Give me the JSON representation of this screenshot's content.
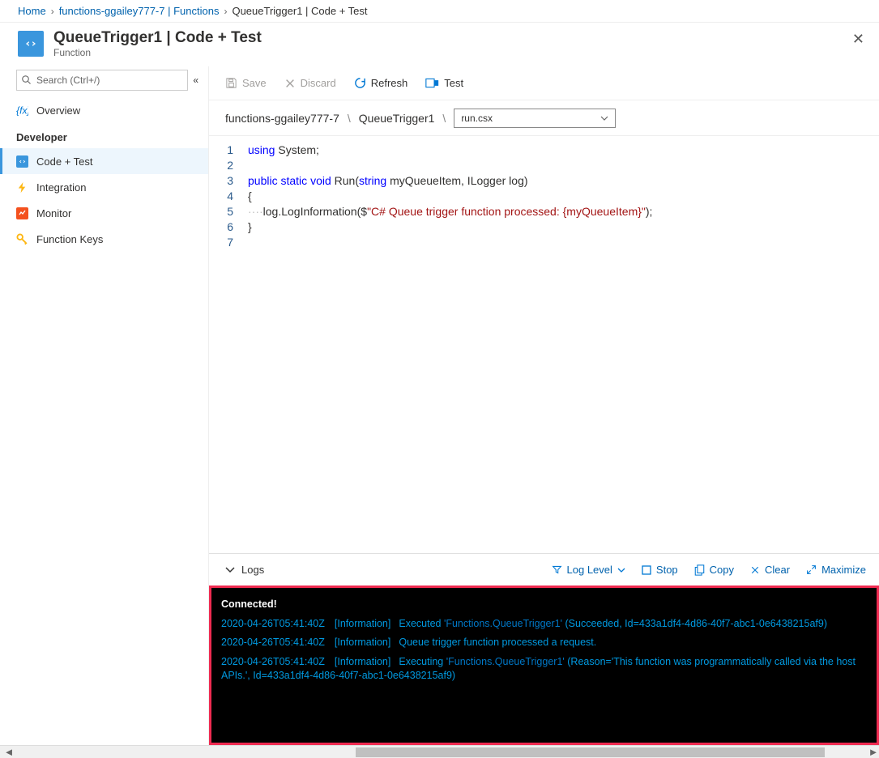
{
  "breadcrumb": {
    "home": "Home",
    "parent": "functions-ggailey777-7 | Functions",
    "current": "QueueTrigger1 | Code + Test"
  },
  "header": {
    "title": "QueueTrigger1 | Code + Test",
    "subtitle": "Function"
  },
  "search": {
    "placeholder": "Search (Ctrl+/)"
  },
  "nav": {
    "overview": "Overview",
    "section_developer": "Developer",
    "code_test": "Code + Test",
    "integration": "Integration",
    "monitor": "Monitor",
    "function_keys": "Function Keys"
  },
  "toolbar": {
    "save": "Save",
    "discard": "Discard",
    "refresh": "Refresh",
    "test": "Test"
  },
  "path": {
    "p1": "functions-ggailey777-7",
    "p2": "QueueTrigger1",
    "file": "run.csx"
  },
  "code": {
    "line1_kw": "using",
    "line1_rest": " System;",
    "line3_kw1": "public",
    "line3_kw2": "static",
    "line3_kw3": "void",
    "line3_fn": " Run(",
    "line3_kw4": "string",
    "line3_rest": " myQueueItem, ILogger log)",
    "line4": "{",
    "line5_indent": "····",
    "line5_call": "log.LogInformation($",
    "line5_str": "\"C# Queue trigger function processed: {myQueueItem}\"",
    "line5_end": ");",
    "line6": "}"
  },
  "logbar": {
    "logs": "Logs",
    "loglevel": "Log Level",
    "stop": "Stop",
    "copy": "Copy",
    "clear": "Clear",
    "maximize": "Maximize"
  },
  "console": {
    "connected": "Connected!",
    "l1_ts": "2020-04-26T05:41:40Z",
    "l1_lv": "[Information]",
    "l1_a": "Executed ",
    "l1_fn": "'Functions.QueueTrigger1'",
    "l1_b": " (Succeeded, Id=433a1df4-4d86-40f7-abc1-0e6438215af9)",
    "l2_ts": "2020-04-26T05:41:40Z",
    "l2_lv": "[Information]",
    "l2_msg": "Queue trigger function processed a request.",
    "l3_ts": "2020-04-26T05:41:40Z",
    "l3_lv": "[Information]",
    "l3_a": "Executing ",
    "l3_fn": "'Functions.QueueTrigger1'",
    "l3_b": " (Reason='This function was programmatically called via the host APIs.', Id=433a1df4-4d86-40f7-abc1-0e6438215af9)"
  }
}
